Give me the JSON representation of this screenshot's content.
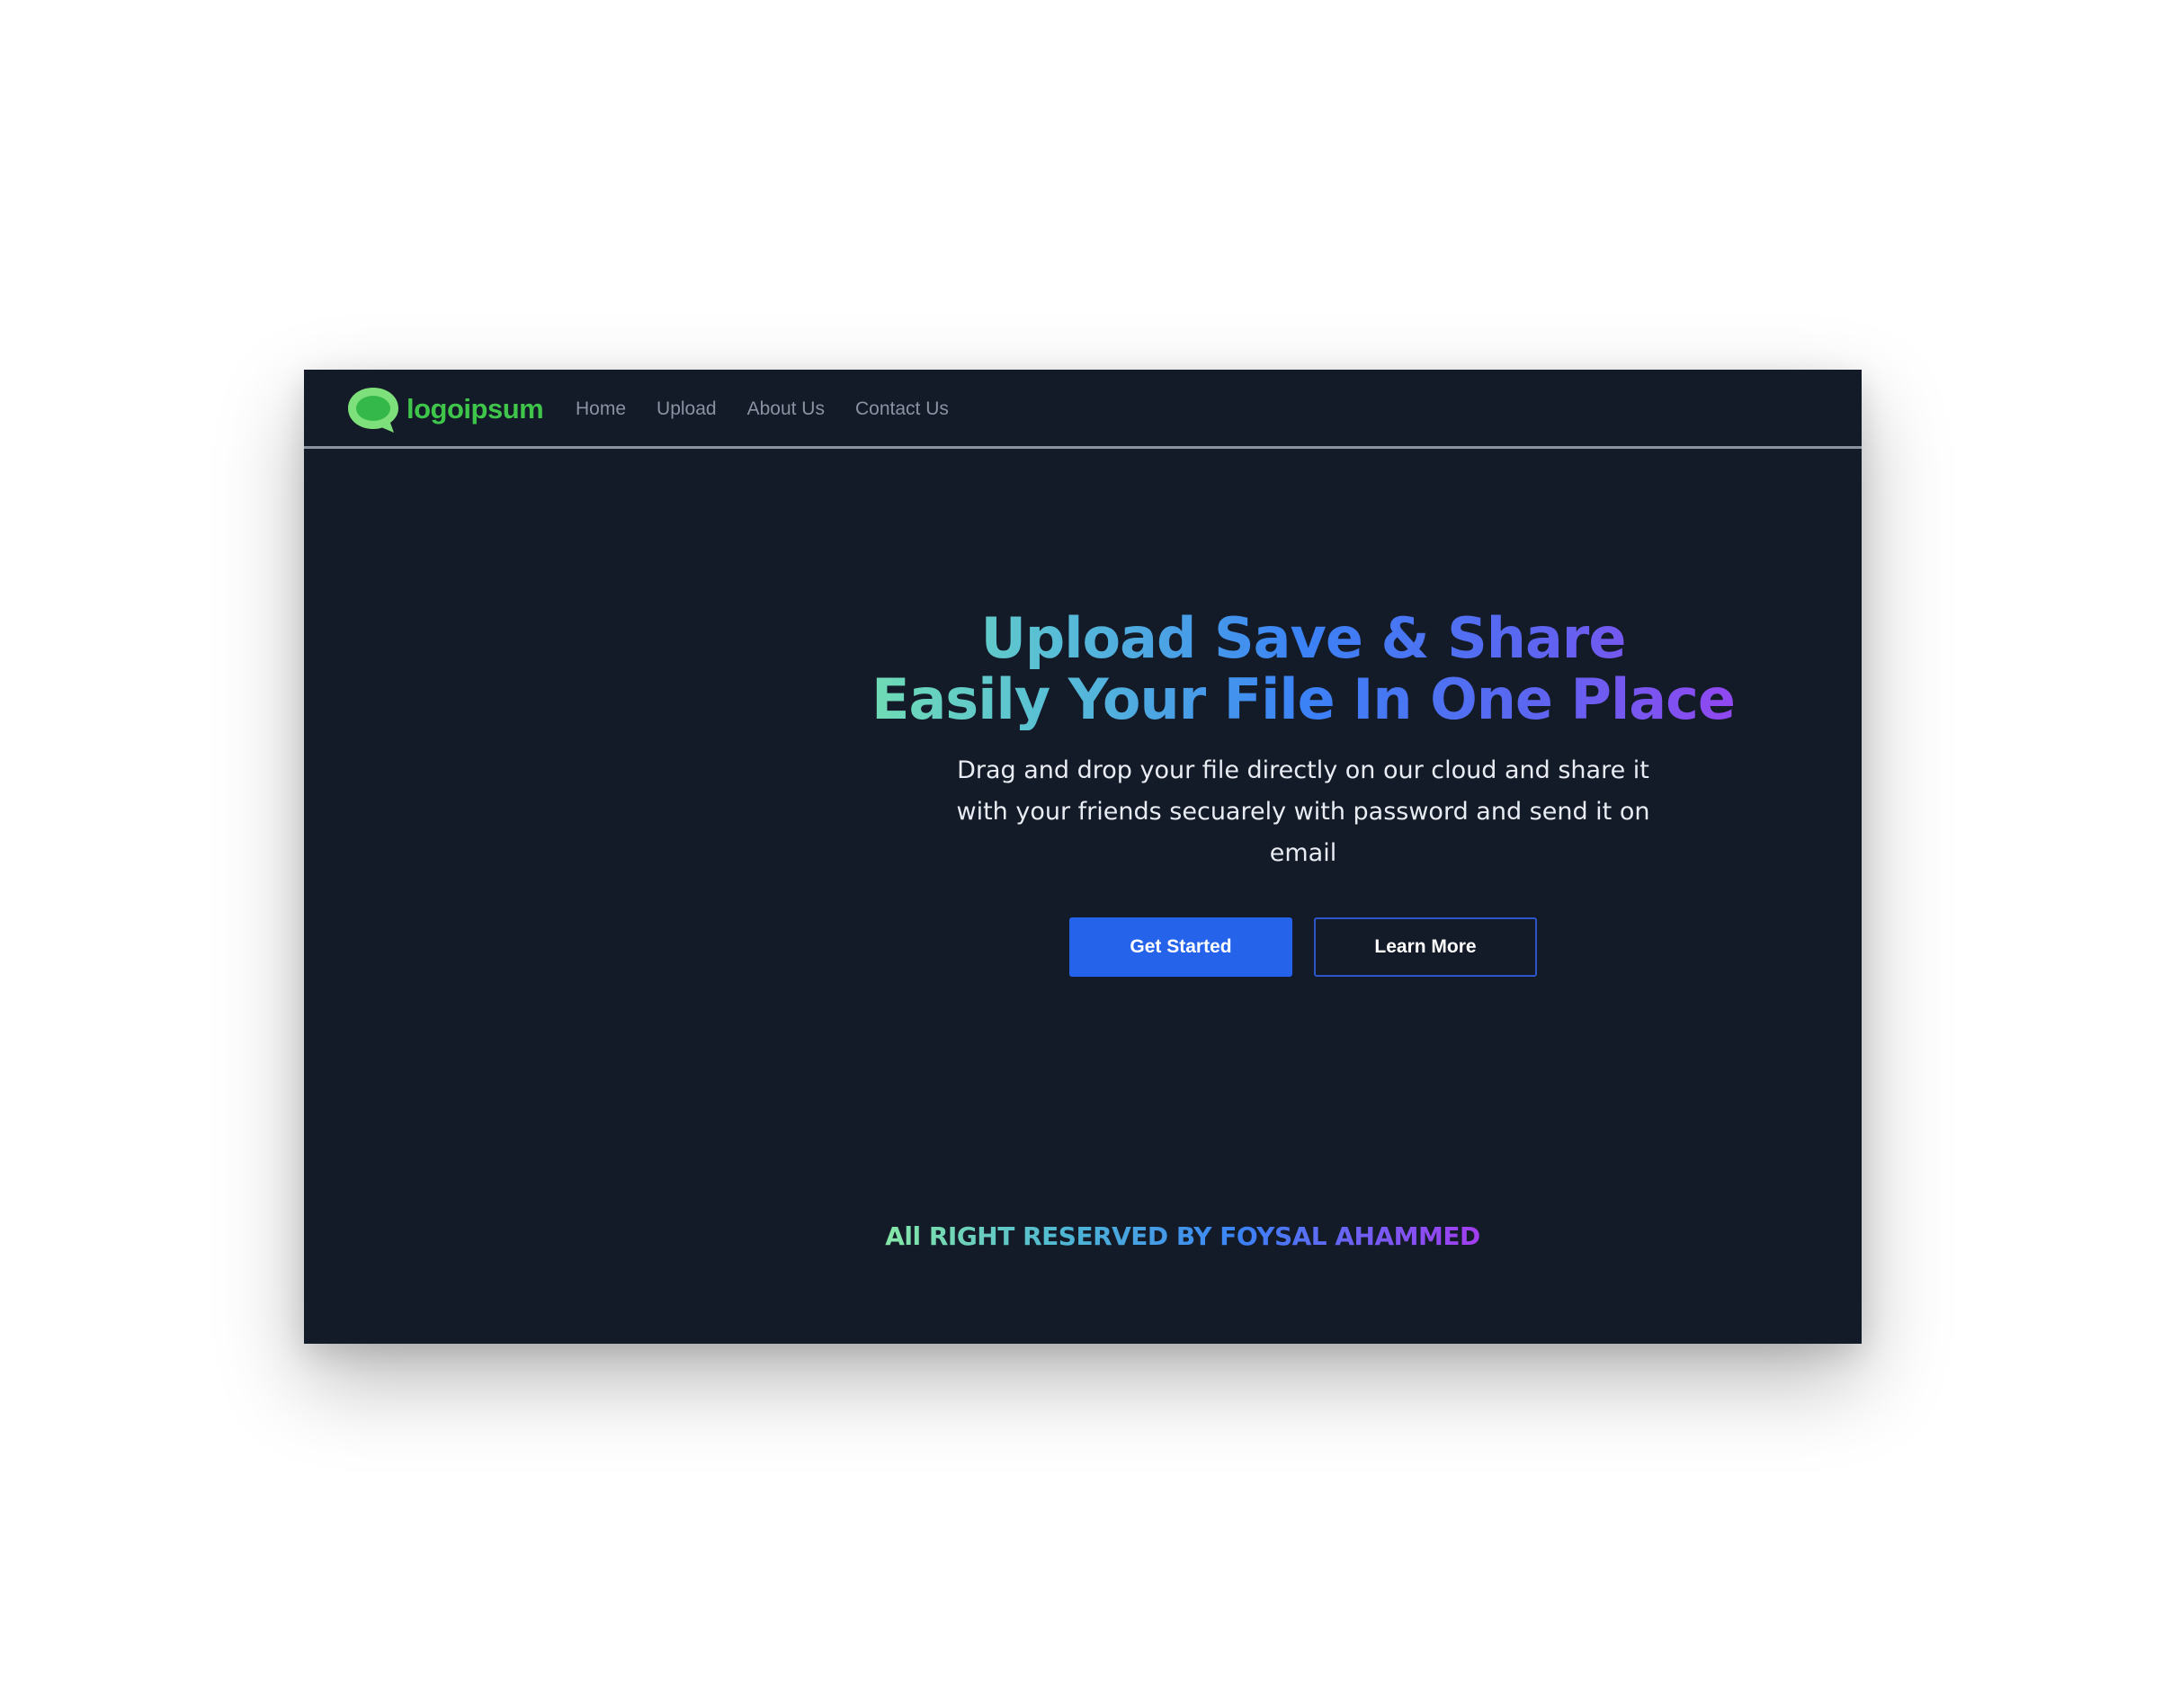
{
  "brand": {
    "name": "logoipsum",
    "color": "#3ec54a"
  },
  "nav": {
    "items": [
      {
        "label": "Home"
      },
      {
        "label": "Upload"
      },
      {
        "label": "About Us"
      },
      {
        "label": "Contact Us"
      }
    ]
  },
  "hero": {
    "title_line1": "Upload Save & Share",
    "title_line2": "Easily Your File In One Place",
    "description": "Drag and drop your file directly on our cloud and share it with your friends secuarely with password and send it on email",
    "primary_cta": "Get Started",
    "secondary_cta": "Learn More"
  },
  "footer": {
    "text": "All RIGHT RESERVED BY FOYSAL AHAMMED"
  },
  "colors": {
    "background": "#131a28",
    "primary": "#2563eb",
    "gradient_start": "#79e8a8",
    "gradient_mid": "#3b82f6",
    "gradient_end": "#a43df0"
  }
}
